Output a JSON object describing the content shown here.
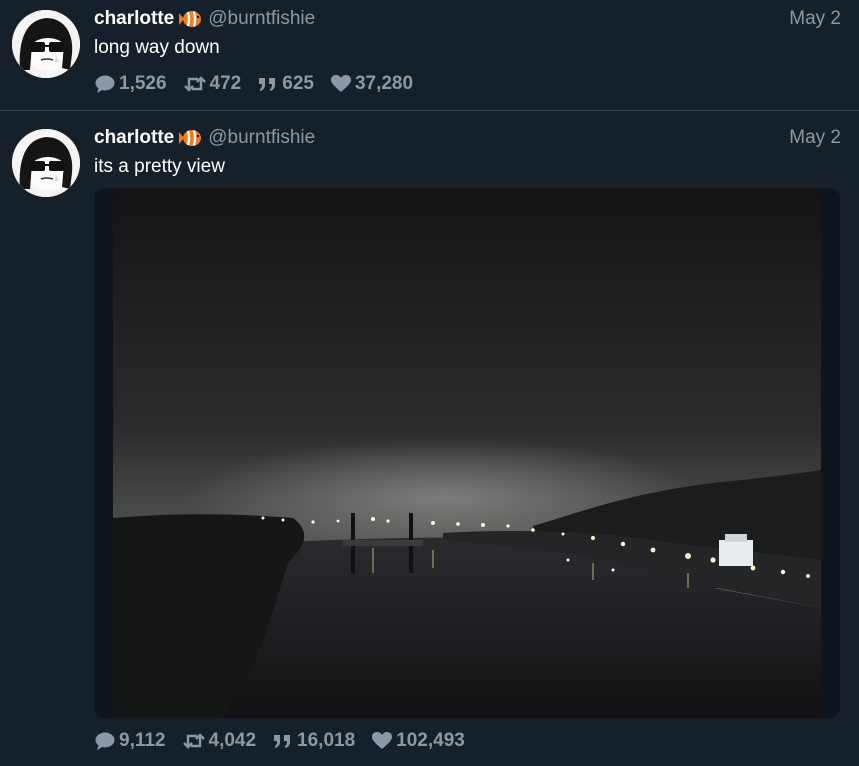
{
  "colors": {
    "background": "#15202b",
    "divider": "#38444d",
    "name": "#ffffff",
    "muted": "#8b98a5",
    "fish_orange": "#f47a20"
  },
  "tweets": [
    {
      "author": {
        "name": "charlotte",
        "handle": "@burntfishie",
        "badge_icon": "fish-emoji-icon"
      },
      "date": "May 2",
      "text": "long way down",
      "stats": {
        "replies": "1,526",
        "retweets": "472",
        "quotes": "625",
        "likes": "37,280"
      }
    },
    {
      "author": {
        "name": "charlotte",
        "handle": "@burntfishie",
        "badge_icon": "fish-emoji-icon"
      },
      "date": "May 2",
      "text": "its a pretty view",
      "media": {
        "type": "photo",
        "description_icon": "night-river-photo"
      },
      "stats": {
        "replies": "9,112",
        "retweets": "4,042",
        "quotes": "16,018",
        "likes": "102,493"
      }
    }
  ]
}
